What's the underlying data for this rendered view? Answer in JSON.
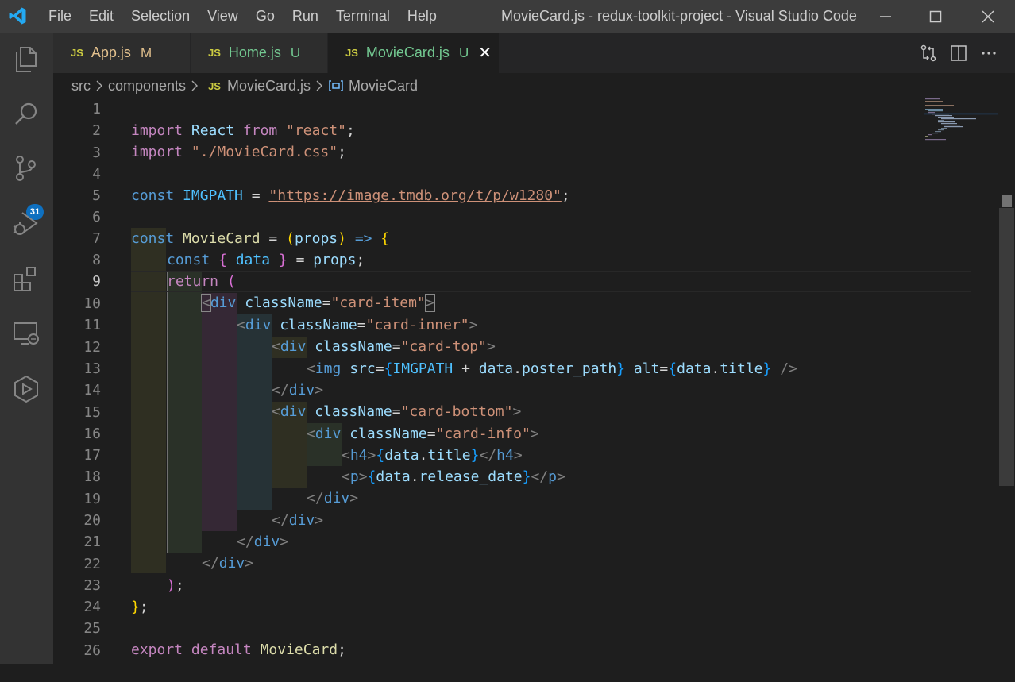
{
  "menu": [
    "File",
    "Edit",
    "Selection",
    "View",
    "Go",
    "Run",
    "Terminal",
    "Help"
  ],
  "window_title": "MovieCard.js - redux-toolkit-project - Visual Studio Code",
  "tabs": [
    {
      "lang": "JS",
      "name": "App.js",
      "flag": "M"
    },
    {
      "lang": "JS",
      "name": "Home.js",
      "flag": "U"
    },
    {
      "lang": "JS",
      "name": "MovieCard.js",
      "flag": "U",
      "close": "✕"
    }
  ],
  "breadcrumb": {
    "src": "src",
    "components": "components",
    "file_lang": "JS",
    "file": "MovieCard.js",
    "symbol": "MovieCard"
  },
  "scm_badge": "31",
  "line_numbers": [
    "1",
    "2",
    "3",
    "4",
    "5",
    "6",
    "7",
    "8",
    "9",
    "10",
    "11",
    "12",
    "13",
    "14",
    "15",
    "16",
    "17",
    "18",
    "19",
    "20",
    "21",
    "22",
    "23",
    "24",
    "25",
    "26"
  ],
  "code": {
    "l1": [
      "import",
      "React",
      "from",
      "\"react\"",
      ";"
    ],
    "l2": [
      "import",
      "\"./MovieCard.css\"",
      ";"
    ],
    "l4": [
      "const",
      "IMGPATH",
      "=",
      "\"",
      "https://image.tmdb.org/t/p/w1280",
      "\"",
      ";"
    ],
    "l6": [
      "const",
      "MovieCard",
      "=",
      "(",
      "props",
      ")",
      "=>",
      "{"
    ],
    "l7": [
      "const",
      "{",
      "data",
      "}",
      "=",
      "props",
      ";"
    ],
    "l8": [
      "return",
      "("
    ],
    "l9": [
      "<",
      "div",
      "className",
      "=",
      "\"card-item\"",
      ">"
    ],
    "l10": [
      "<",
      "div",
      "className",
      "=",
      "\"card-inner\"",
      ">"
    ],
    "l11": [
      "<",
      "div",
      "className",
      "=",
      "\"card-top\"",
      ">"
    ],
    "l12": [
      "<",
      "img",
      "src",
      "=",
      "{",
      "IMGPATH",
      "+",
      "data",
      ".",
      "poster_path",
      "}",
      "alt",
      "=",
      "{",
      "data",
      ".",
      "title",
      "}",
      "/>"
    ],
    "l13": [
      "</",
      "div",
      ">"
    ],
    "l14": [
      "<",
      "div",
      "className",
      "=",
      "\"card-bottom\"",
      ">"
    ],
    "l15": [
      "<",
      "div",
      "className",
      "=",
      "\"card-info\"",
      ">"
    ],
    "l16": [
      "<",
      "h4",
      ">",
      "{",
      "data",
      ".",
      "title",
      "}",
      "</",
      "h4",
      ">"
    ],
    "l17": [
      "<",
      "p",
      ">",
      "{",
      "data",
      ".",
      "release_date",
      "}",
      "</",
      "p",
      ">"
    ],
    "l18": [
      "</",
      "div",
      ">"
    ],
    "l19": [
      "</",
      "div",
      ">"
    ],
    "l20": [
      "</",
      "div",
      ">"
    ],
    "l21": [
      "</",
      "div",
      ">"
    ],
    "l22": [
      ")",
      ";"
    ],
    "l23": [
      "}",
      ";"
    ],
    "l25": [
      "export",
      "default",
      "MovieCard",
      ";"
    ]
  },
  "colors": {
    "accent": "#0e70c0",
    "modified": "#e2c08d",
    "untracked": "#73c991"
  }
}
